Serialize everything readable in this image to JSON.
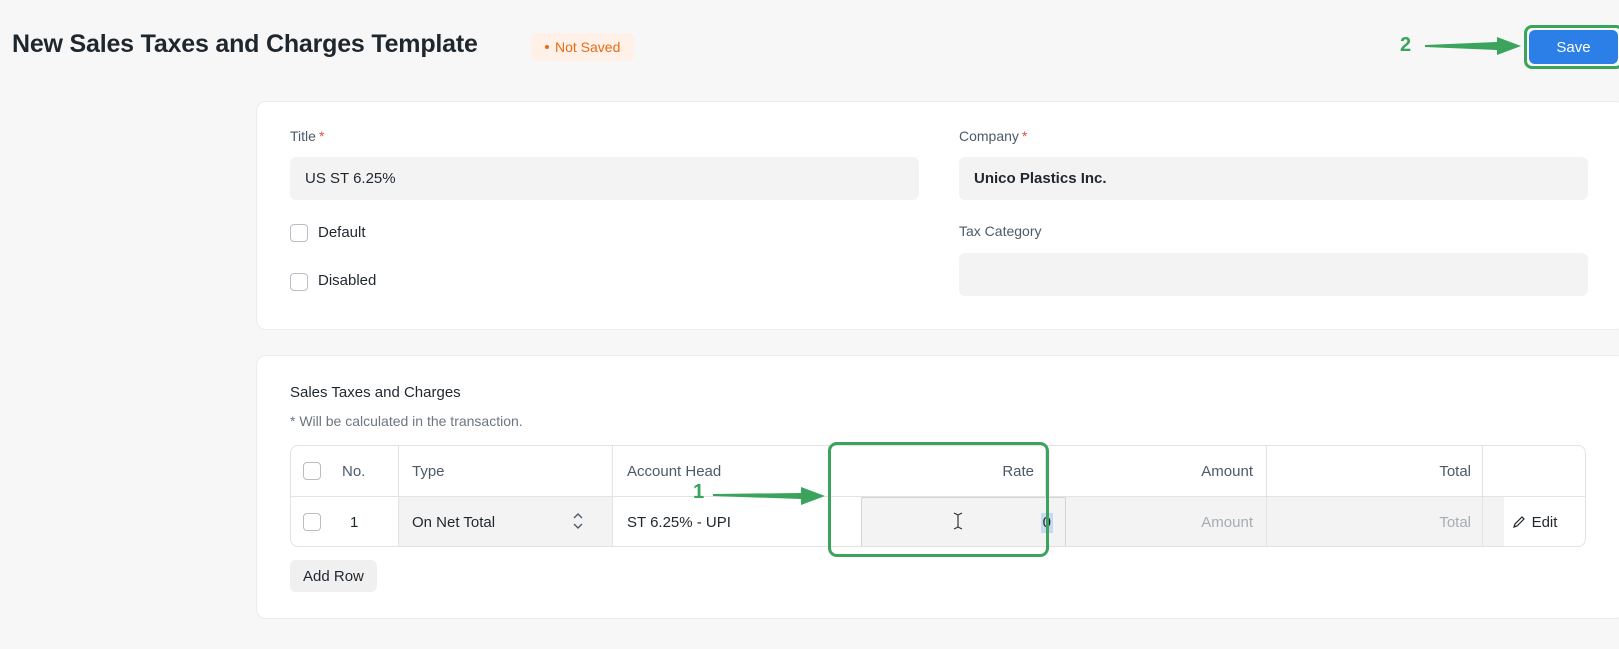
{
  "header": {
    "title": "New Sales Taxes and Charges Template",
    "status": "Not Saved",
    "save_label": "Save"
  },
  "annotations": {
    "step1": "1",
    "step2": "2"
  },
  "details": {
    "title_label": "Title",
    "title_value": "US ST 6.25%",
    "company_label": "Company",
    "company_value": "Unico Plastics Inc.",
    "default_label": "Default",
    "disabled_label": "Disabled",
    "tax_category_label": "Tax Category",
    "tax_category_value": "",
    "required_marker": "*"
  },
  "taxes": {
    "section_title": "Sales Taxes and Charges",
    "description": "* Will be calculated in the transaction.",
    "columns": [
      "No.",
      "Type",
      "Account Head",
      "Rate",
      "Amount",
      "Total"
    ],
    "rows": [
      {
        "no": "1",
        "type": "On Net Total",
        "account_head": "ST 6.25% - UPI",
        "rate": "0",
        "amount_placeholder": "Amount",
        "total_placeholder": "Total",
        "edit_label": "Edit"
      }
    ],
    "add_row_label": "Add Row"
  },
  "colors": {
    "primary": "#2b7fe6",
    "annotation": "#3aa35c",
    "not_saved": "#e86c13"
  }
}
